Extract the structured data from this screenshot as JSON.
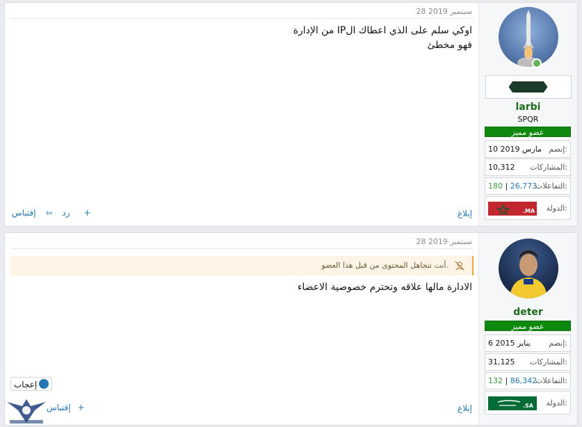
{
  "posts": [
    {
      "date": "28 سبتمبر 2019",
      "message_lines": [
        "اوكي سلم على الذي اعطاك الIP من الإدارة",
        "فهو مخطئ"
      ],
      "report_label": "إبلاغ",
      "reply_label": "رد",
      "quote_label": "إقتباس",
      "user": {
        "name": "larbi",
        "title": "SPQR",
        "banner": "عضو مميز",
        "joined_label": "إنضم:",
        "joined_value": "10 مارس 2019",
        "posts_label": "المشاركات:",
        "posts_value": "10,312",
        "reactions_label": "التفاعلات:",
        "reactions_value": "26,773",
        "reactions_points": "180",
        "country_label": "الدولة:",
        "flag_code": ".MA"
      }
    },
    {
      "date": "28 سبتمبر 2019",
      "ignored_notice": "أنت تتجاهل المحتوى من قبل هذا العضو.",
      "message_lines": [
        "الادارة مالها علاقه وتحترم خصوصية الاعضاء"
      ],
      "like_label": "إعجاب",
      "report_label": "إبلاغ",
      "quote_label": "إقتباس",
      "user": {
        "name": "deter",
        "banner": "عضو مميز",
        "joined_label": "إنضم:",
        "joined_value": "6 يناير 2015",
        "posts_label": "المشاركات:",
        "posts_value": "31,125",
        "reactions_label": "التفاعلات:",
        "reactions_value": "86,342",
        "reactions_points": "132",
        "country_label": "الدولة:",
        "flag_code": ".SA"
      }
    }
  ],
  "colors": {
    "link": "#2577b1",
    "username": "#1b6b1a",
    "banner": "#0d8a0d"
  }
}
